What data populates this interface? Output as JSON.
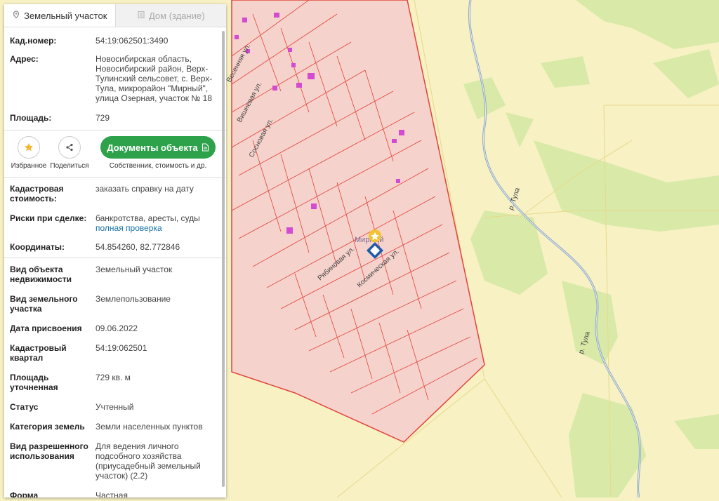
{
  "tabs": [
    {
      "label": "Земельный участок",
      "icon": "pin-icon",
      "active": true
    },
    {
      "label": "Дом (здание)",
      "icon": "building-icon",
      "active": false
    }
  ],
  "parcel": {
    "cad_label": "Кад.номер:",
    "cad_number": "54:19:062501:3490",
    "address_label": "Адрес:",
    "address": "Новосибирская область, Новосибирский район, Верх-Тулинский сельсовет, с. Верх-Тула, микрорайон \"Мирный\", улица Озерная, участок № 18",
    "area_label": "Площадь:",
    "area": "729"
  },
  "actions": {
    "favorite_label": "Избранное",
    "share_label": "Поделиться",
    "documents_button": "Документы объекта",
    "documents_sub": "Собственник, стоимость и др."
  },
  "details": {
    "cad_value_label": "Кадастровая стоимость:",
    "cad_value_link": "заказать справку на дату",
    "risks_label": "Риски при сделке:",
    "risks_text": "банкротства, аресты, суды",
    "risks_link": "полная проверка",
    "coords_label": "Координаты:",
    "coords": "54.854260, 82.772846"
  },
  "props": [
    {
      "label": "Вид объекта недвижимости",
      "value": "Земельный участок"
    },
    {
      "label": "Вид земельного участка",
      "value": "Землепользование"
    },
    {
      "label": "Дата присвоения",
      "value": "09.06.2022"
    },
    {
      "label": "Кадастровый квартал",
      "value": "54:19:062501"
    },
    {
      "label": "Площадь уточненная",
      "value": "729 кв. м"
    },
    {
      "label": "Статус",
      "value": "Учтенный"
    },
    {
      "label": "Категория земель",
      "value": "Земли населенных пунктов"
    },
    {
      "label": "Вид разрешенного использования",
      "value": "Для ведения личного подсобного хозяйства (приусадебный земельный участок) (2.2)"
    },
    {
      "label": "Форма собственности",
      "value": "Частная"
    }
  ],
  "map": {
    "streets": [
      "Вишневая ул.",
      "Сосновая ул.",
      "Рябиновая ул.",
      "Космическая ул.",
      "Весенняя ул."
    ],
    "river": "р. Тула",
    "district": "Мирный",
    "colors": {
      "background": "#f7f1c4",
      "settlement": "#f6d2cc",
      "boundary": "#e0443a",
      "green": "#d9e9a8",
      "river": "#8aa8d8",
      "building": "#d24bd0",
      "accent": "#2ea24b",
      "link": "#1a73a8"
    }
  }
}
